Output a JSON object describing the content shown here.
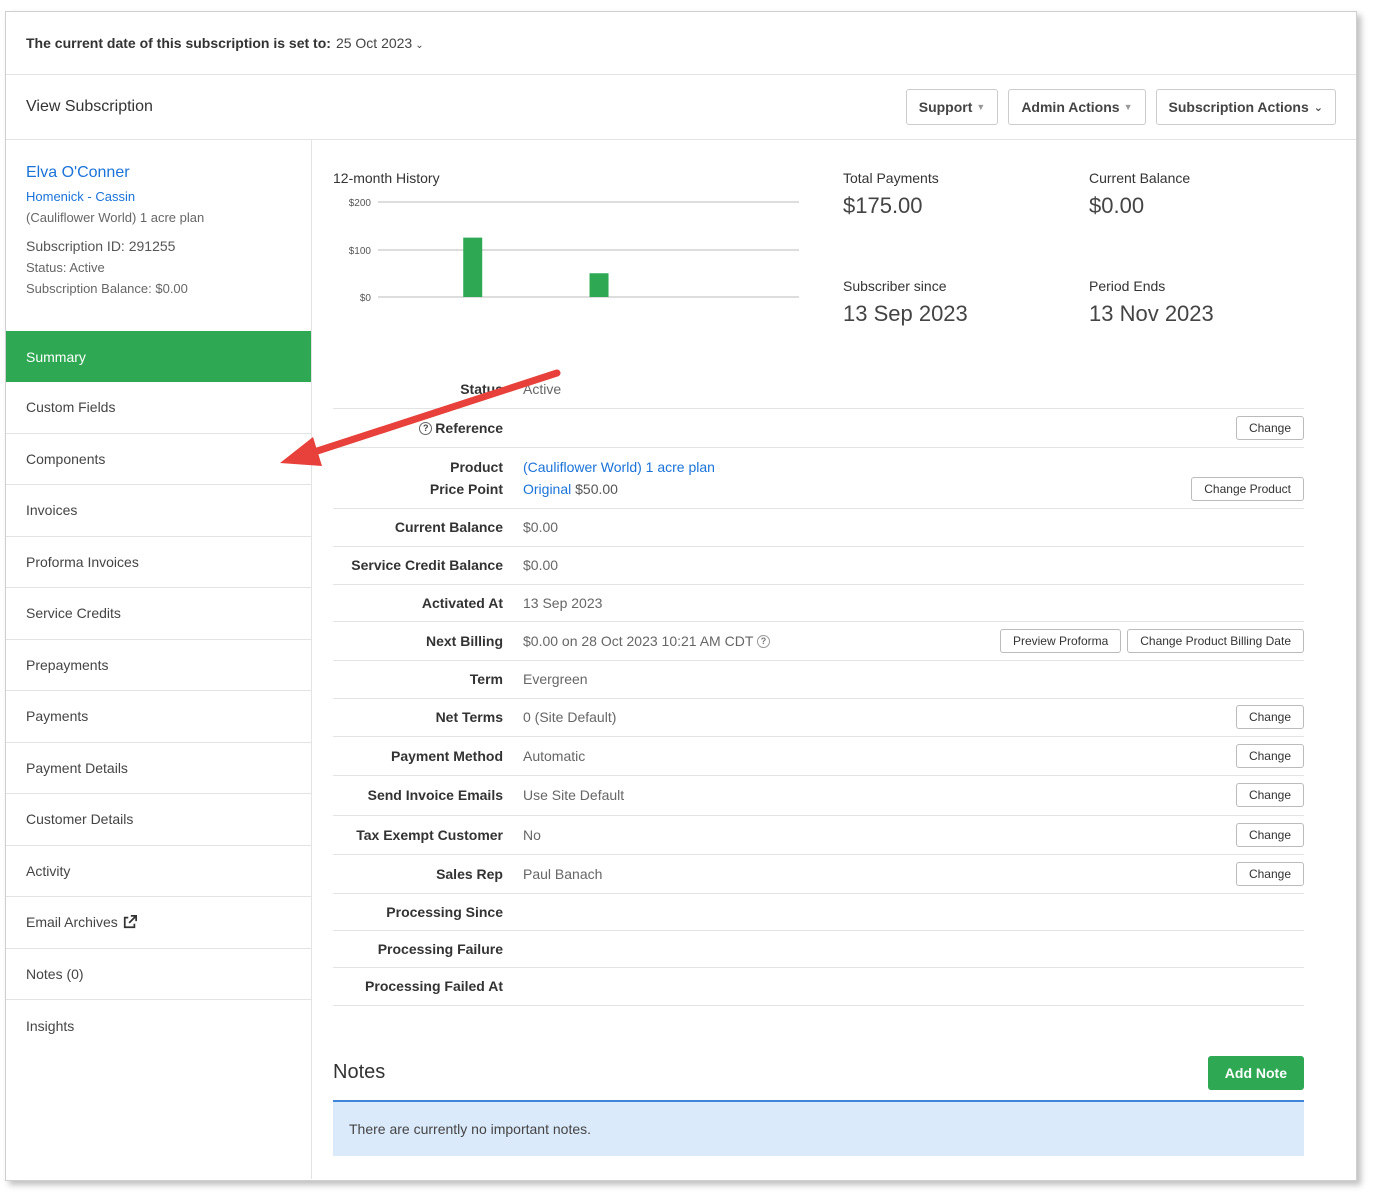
{
  "topbar": {
    "label": "The current date of this subscription is set to:",
    "date": "25 Oct 2023"
  },
  "header": {
    "title": "View Subscription",
    "buttons": [
      "Support",
      "Admin Actions",
      "Subscription Actions"
    ]
  },
  "customer": {
    "name": "Elva O'Conner",
    "org": "Homenick - Cassin",
    "plan": "(Cauliflower World) 1 acre plan",
    "subscription_id": "Subscription ID: 291255",
    "status": "Status: Active",
    "balance": "Subscription Balance: $0.00"
  },
  "nav": [
    "Summary",
    "Custom Fields",
    "Components",
    "Invoices",
    "Proforma Invoices",
    "Service Credits",
    "Prepayments",
    "Payments",
    "Payment Details",
    "Customer Details",
    "Activity",
    "Email Archives",
    "Notes (0)",
    "Insights"
  ],
  "chart_data": {
    "type": "bar",
    "title": "12-month History",
    "ticks": [
      "$200",
      "$100",
      "$0"
    ],
    "ylim": [
      0,
      200
    ],
    "values": [
      0,
      0,
      0,
      0,
      125,
      0,
      0,
      0,
      0,
      0,
      50,
      0,
      0,
      0,
      0,
      0,
      0,
      0,
      0,
      0
    ]
  },
  "stats": {
    "total_payments_label": "Total Payments",
    "total_payments": "$175.00",
    "current_balance_label": "Current Balance",
    "current_balance": "$0.00",
    "subscriber_since_label": "Subscriber since",
    "subscriber_since": "13 Sep 2023",
    "period_ends_label": "Period Ends",
    "period_ends": "13 Nov 2023"
  },
  "details": {
    "status_k": "Status",
    "status_v": "Active",
    "reference_k": "Reference",
    "product_k": "Product",
    "product_v": "(Cauliflower World) 1 acre plan",
    "price_point_k": "Price Point",
    "price_point_link": "Original",
    "price_point_v": "$50.00",
    "current_balance_k": "Current Balance",
    "current_balance_v": "$0.00",
    "service_credit_k": "Service Credit Balance",
    "service_credit_v": "$0.00",
    "activated_k": "Activated At",
    "activated_v": "13 Sep 2023",
    "next_billing_k": "Next Billing",
    "next_billing_v": "$0.00 on 28 Oct 2023 10:21 AM CDT",
    "term_k": "Term",
    "term_v": "Evergreen",
    "net_terms_k": "Net Terms",
    "net_terms_v": "0 (Site Default)",
    "payment_method_k": "Payment Method",
    "payment_method_v": "Automatic",
    "send_invoice_k": "Send Invoice Emails",
    "send_invoice_v": "Use Site Default",
    "tax_exempt_k": "Tax Exempt Customer",
    "tax_exempt_v": "No",
    "sales_rep_k": "Sales Rep",
    "sales_rep_v": "Paul Banach",
    "processing_since_k": "Processing Since",
    "processing_failure_k": "Processing Failure",
    "processing_failed_at_k": "Processing Failed At"
  },
  "buttons": {
    "change": "Change",
    "change_product": "Change Product",
    "preview_proforma": "Preview Proforma",
    "change_billing_date": "Change Product Billing Date",
    "add_note": "Add Note"
  },
  "notes": {
    "title": "Notes",
    "empty": "There are currently no important notes."
  },
  "colors": {
    "accent": "#2ea853",
    "link": "#1a73d9",
    "arrow": "#e8403a"
  }
}
